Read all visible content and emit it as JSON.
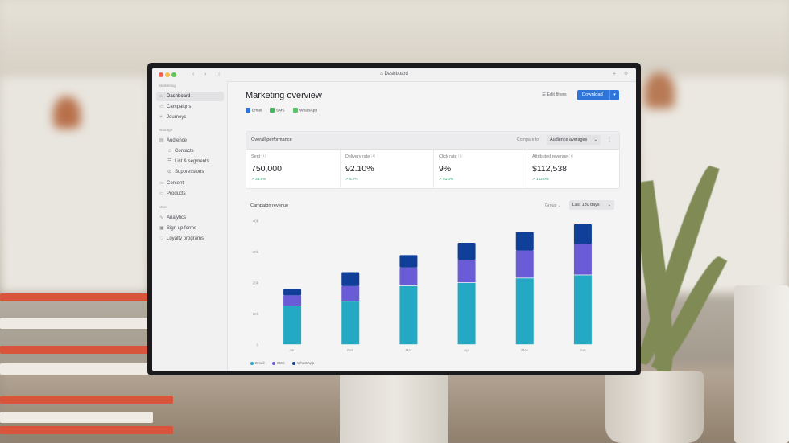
{
  "window": {
    "title": "Dashboard"
  },
  "sidebar": {
    "sections": [
      "Marketing",
      "Manage",
      "More"
    ],
    "items": [
      {
        "label": "Dashboard",
        "icon": "home-icon",
        "active": true
      },
      {
        "label": "Campaigns",
        "icon": "campaigns-icon"
      },
      {
        "label": "Journeys",
        "icon": "journeys-icon"
      },
      {
        "label": "Audience",
        "icon": "audience-icon"
      },
      {
        "label": "Contacts",
        "icon": "contacts-icon"
      },
      {
        "label": "List & segments",
        "icon": "list-icon"
      },
      {
        "label": "Suppressions",
        "icon": "suppressions-icon"
      },
      {
        "label": "Content",
        "icon": "folder-icon"
      },
      {
        "label": "Products",
        "icon": "folder-icon"
      },
      {
        "label": "Analytics",
        "icon": "analytics-icon"
      },
      {
        "label": "Sign up forms",
        "icon": "forms-icon"
      },
      {
        "label": "Loyalty programs",
        "icon": "heart-icon"
      }
    ]
  },
  "header": {
    "title": "Marketing overview",
    "channels": [
      "Email",
      "SMS",
      "WhatsApp"
    ],
    "edit_filters": "Edit filters",
    "download": "Download"
  },
  "performance": {
    "title": "Overall performance",
    "compare_label": "Compare to:",
    "compare_value": "Audience averages",
    "metrics": [
      {
        "label": "Sent",
        "value": "750,000",
        "delta": "38.8%"
      },
      {
        "label": "Delivery rate",
        "value": "92.10%",
        "delta": "5.7%"
      },
      {
        "label": "Click rate",
        "value": "9%",
        "delta": "51.0%"
      },
      {
        "label": "Attributed revenue",
        "value": "$112,538",
        "delta": "152.0%"
      }
    ]
  },
  "revenue": {
    "title": "Campaign revenue",
    "group_label": "Group",
    "range": "Last 180 days"
  },
  "colors": {
    "email": "#23a9c4",
    "sms": "#6a5cd6",
    "whatsapp": "#0f3f99",
    "accent": "#2f74d8"
  },
  "chart_data": {
    "type": "bar",
    "stacked": true,
    "categories": [
      "Jan",
      "Feb",
      "Mar",
      "Apr",
      "May",
      "Jun"
    ],
    "series": [
      {
        "name": "Email",
        "values": [
          12.5,
          14,
          19,
          20,
          21.5,
          22.5
        ]
      },
      {
        "name": "SMS",
        "values": [
          3.5,
          5,
          6,
          7.5,
          9,
          10
        ]
      },
      {
        "name": "WhatsApp",
        "values": [
          2,
          4.5,
          4,
          5.5,
          6,
          6.5
        ]
      }
    ],
    "yticks": [
      "0",
      "10k",
      "20k",
      "30k",
      "40k"
    ],
    "ylim": [
      0,
      40
    ],
    "legend": "bottom-left",
    "grid": false
  }
}
